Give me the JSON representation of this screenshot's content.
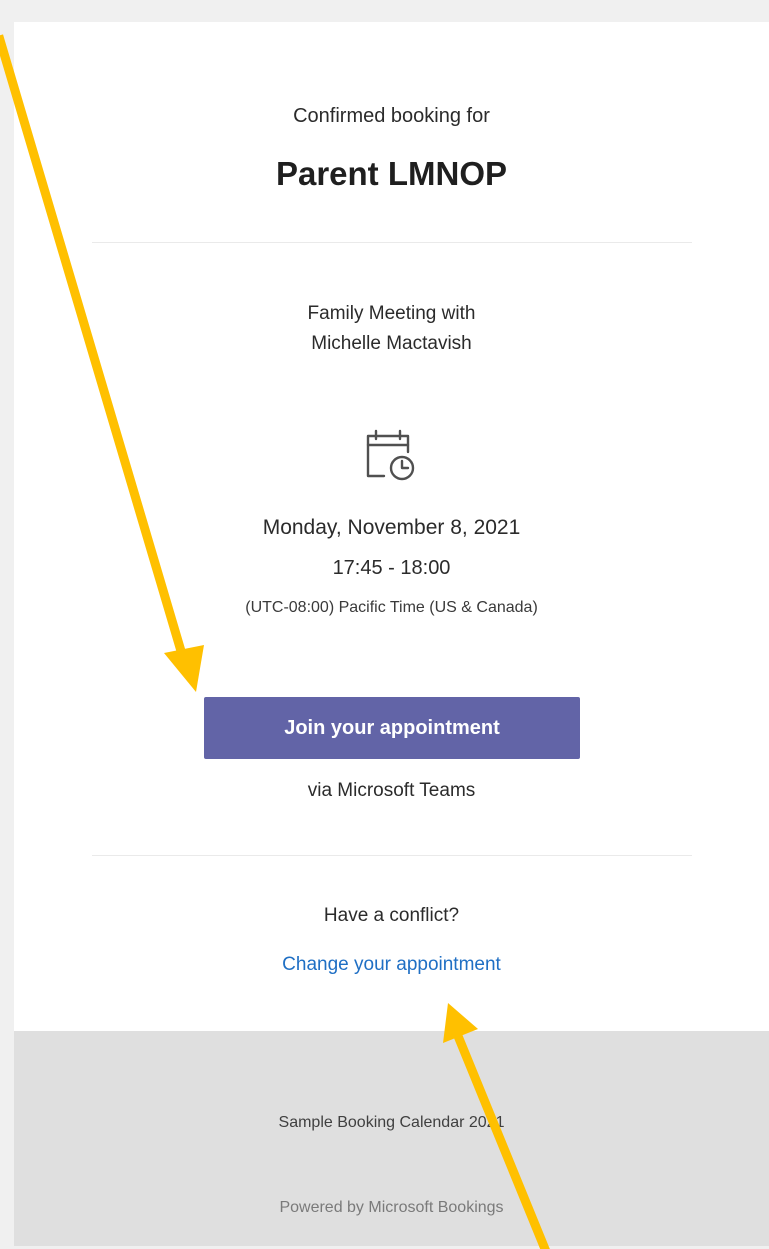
{
  "booking": {
    "lead_text": "Confirmed booking for",
    "name": "Parent LMNOP"
  },
  "meeting": {
    "line1": "Family Meeting with",
    "line2": "Michelle Mactavish",
    "icon": "calendar-clock-icon"
  },
  "schedule": {
    "date": "Monday, November 8, 2021",
    "time": "17:45 - 18:00",
    "timezone": "(UTC-08:00) Pacific Time (US & Canada)"
  },
  "join": {
    "button_label": "Join your appointment",
    "via": "via Microsoft Teams"
  },
  "conflict": {
    "prompt": "Have a conflict?",
    "link_label": "Change your appointment"
  },
  "footer": {
    "calendar_name": "Sample Booking Calendar 2021",
    "powered_by": "Powered by Microsoft Bookings"
  },
  "colors": {
    "button": "#6264a7",
    "link": "#1f6fc4",
    "footer_bg": "#dfdfdf",
    "annotation_arrow": "#ffc000"
  }
}
